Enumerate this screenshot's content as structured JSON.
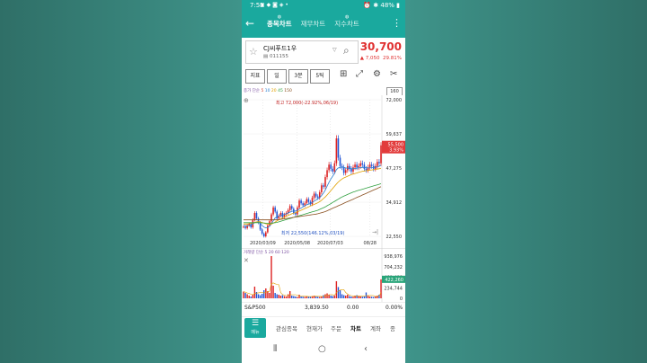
{
  "status_bar": {
    "time": "7:51",
    "icons": "▣ ◆ ◙ ◈ •",
    "right": "⏰ ✱ 48% ▮"
  },
  "header": {
    "tabs": [
      {
        "label": "종목차트",
        "active": true
      },
      {
        "label": "재무차트",
        "active": false
      },
      {
        "label": "지수차트",
        "active": false
      }
    ]
  },
  "stock": {
    "name": "CJ씨푸드1우",
    "code": "011155",
    "price": "30,700",
    "change": "▲ 7,050",
    "change_pct": "29.81%"
  },
  "toolbar": {
    "buttons": [
      "지표",
      "일",
      "3분",
      "5틱"
    ]
  },
  "indicators": {
    "label": "종가 단순",
    "ma": [
      "5",
      "10",
      "20",
      "45",
      "150"
    ],
    "period": "160"
  },
  "chart_data": {
    "type": "line",
    "title": "",
    "max_annotation": "최고 72,000(-22.92%,06/19)",
    "min_annotation": "최저 22,550(146.12%,03/19)",
    "x_tick_labels": [
      "2020/03/09",
      "2020/05/08",
      "2020/07/03",
      "08/28"
    ],
    "y_tick_labels": [
      "72,000",
      "59,637",
      "47,275",
      "34,912",
      "22,550"
    ],
    "current_label": "55,500",
    "current_pct": "3.93%",
    "ylim": [
      22550,
      72000
    ],
    "series": [
      {
        "values": [
          26000,
          25500,
          26500,
          27000,
          25800,
          28500,
          31000,
          29000,
          27500,
          25000,
          23500,
          22550,
          24000,
          26500,
          28000,
          30500,
          33000,
          31500,
          29000,
          30000,
          31000,
          29500,
          30500,
          31000,
          32000,
          33500,
          32500,
          31000,
          30500,
          33000,
          35500,
          34500,
          33800,
          34500,
          36000,
          35000,
          34200,
          36500,
          38000,
          37000,
          36500,
          38500,
          41000,
          40500,
          44000,
          46500,
          48500,
          47000,
          46000,
          49000,
          58000,
          51000,
          48000,
          47500,
          45500,
          46500,
          48000,
          47000,
          46000,
          47500,
          48500,
          47500,
          48000,
          49000,
          48500,
          47000,
          46500,
          47500,
          48500,
          48000,
          47000,
          48000,
          49500,
          49000,
          55500
        ]
      },
      {
        "values": [
          26500,
          26400,
          26300,
          26500,
          26700,
          27000,
          27500,
          27800,
          27700,
          27200,
          26500,
          25900,
          25600,
          25700,
          26200,
          27000,
          28200,
          29200,
          29600,
          29900,
          30100,
          30300,
          30500,
          30700,
          31000,
          31300,
          31600,
          31700,
          31800,
          32000,
          32400,
          32800,
          33200,
          33600,
          34000,
          34200,
          34400,
          34800,
          35300,
          35700,
          36100,
          36600,
          37300,
          38200,
          39300,
          40700,
          42100,
          43300,
          44300,
          45300,
          46700,
          47300,
          47500,
          47600,
          47500,
          47300,
          47200,
          47100,
          47000,
          47000,
          47100,
          47200,
          47300,
          47400,
          47500,
          47500,
          47400,
          47300,
          47300,
          47400,
          47500,
          47600,
          47700,
          47900,
          48300
        ]
      },
      {
        "values": [
          27000,
          27000,
          27000,
          27100,
          27200,
          27400,
          27600,
          27800,
          27900,
          27800,
          27600,
          27300,
          27100,
          26900,
          26900,
          27000,
          27300,
          27700,
          28100,
          28500,
          28900,
          29200,
          29500,
          29800,
          30100,
          30400,
          30700,
          30900,
          31100,
          31400,
          31700,
          32000,
          32300,
          32600,
          32900,
          33200,
          33500,
          33800,
          34100,
          34400,
          34700,
          35100,
          35600,
          36200,
          36800,
          37500,
          38300,
          39100,
          39900,
          40700,
          41500,
          42200,
          42800,
          43300,
          43700,
          44000,
          44300,
          44600,
          44900,
          45100,
          45300,
          45500,
          45700,
          45900,
          46100,
          46200,
          46300,
          46400,
          46500,
          46600,
          46700,
          46800,
          46900,
          47000,
          47200
        ]
      },
      {
        "values": [
          27500,
          27500,
          27500,
          27500,
          27500,
          27500,
          27500,
          27500,
          27500,
          27500,
          27400,
          27400,
          27300,
          27300,
          27300,
          27300,
          27400,
          27500,
          27600,
          27800,
          28000,
          28200,
          28400,
          28600,
          28800,
          29000,
          29200,
          29400,
          29600,
          29800,
          30000,
          30200,
          30400,
          30600,
          30800,
          31000,
          31200,
          31400,
          31600,
          31800,
          32000,
          32300,
          32600,
          32900,
          33200,
          33600,
          34000,
          34400,
          34800,
          35200,
          35600,
          36000,
          36400,
          36800,
          37100,
          37400,
          37700,
          38000,
          38300,
          38600,
          38800,
          39000,
          39200,
          39400,
          39600,
          39800,
          40000,
          40200,
          40400,
          40600,
          40800,
          41000,
          41200,
          41400,
          41600
        ]
      },
      {
        "values": [
          28500,
          28500,
          28500,
          28500,
          28500,
          28500,
          28500,
          28500,
          28500,
          28500,
          28500,
          28500,
          28500,
          28500,
          28500,
          28500,
          28500,
          28500,
          28500,
          28600,
          28700,
          28800,
          28900,
          29000,
          29100,
          29200,
          29300,
          29400,
          29500,
          29600,
          29700,
          29800,
          29900,
          30000,
          30100,
          30200,
          30300,
          30400,
          30500,
          30600,
          30700,
          30900,
          31100,
          31300,
          31500,
          31800,
          32100,
          32400,
          32700,
          33000,
          33300,
          33600,
          33900,
          34200,
          34500,
          34800,
          35100,
          35400,
          35700,
          36000,
          36300,
          36600,
          36900,
          37200,
          37500,
          37800,
          38100,
          38400,
          38700,
          39000,
          39300,
          39600,
          39900,
          40200,
          40500
        ]
      }
    ],
    "volume": {
      "label": "거래량 단순",
      "ma": [
        "5",
        "20",
        "60",
        "120"
      ],
      "y_tick_labels": [
        "938,976",
        "704,232",
        "469,488",
        "234,744",
        "0"
      ],
      "current_label": "422,260",
      "values": [
        150000,
        120000,
        90000,
        60000,
        40000,
        80000,
        260000,
        140000,
        90000,
        70000,
        100000,
        180000,
        220000,
        160000,
        120000,
        938976,
        280000,
        120000,
        90000,
        80000,
        60000,
        70000,
        50000,
        40000,
        90000,
        160000,
        60000,
        50000,
        40000,
        30000,
        80000,
        40000,
        35000,
        30000,
        45000,
        40000,
        35000,
        50000,
        60000,
        40000,
        35000,
        30000,
        45000,
        70000,
        90000,
        110000,
        80000,
        60000,
        50000,
        60000,
        380000,
        250000,
        180000,
        90000,
        70000,
        60000,
        80000,
        50000,
        40000,
        35000,
        60000,
        70000,
        50000,
        40000,
        35000,
        40000,
        130000,
        60000,
        40000,
        35000,
        30000,
        45000,
        60000,
        80000,
        422260
      ]
    }
  },
  "index_row": {
    "name": "S&P500",
    "value": "3,839.50",
    "change": "0.00",
    "pct": "0.00%"
  },
  "bottom_nav": {
    "menu": "메뉴",
    "items": [
      "관심종목",
      "현재가",
      "주문",
      "차트",
      "계좌",
      "종"
    ]
  }
}
